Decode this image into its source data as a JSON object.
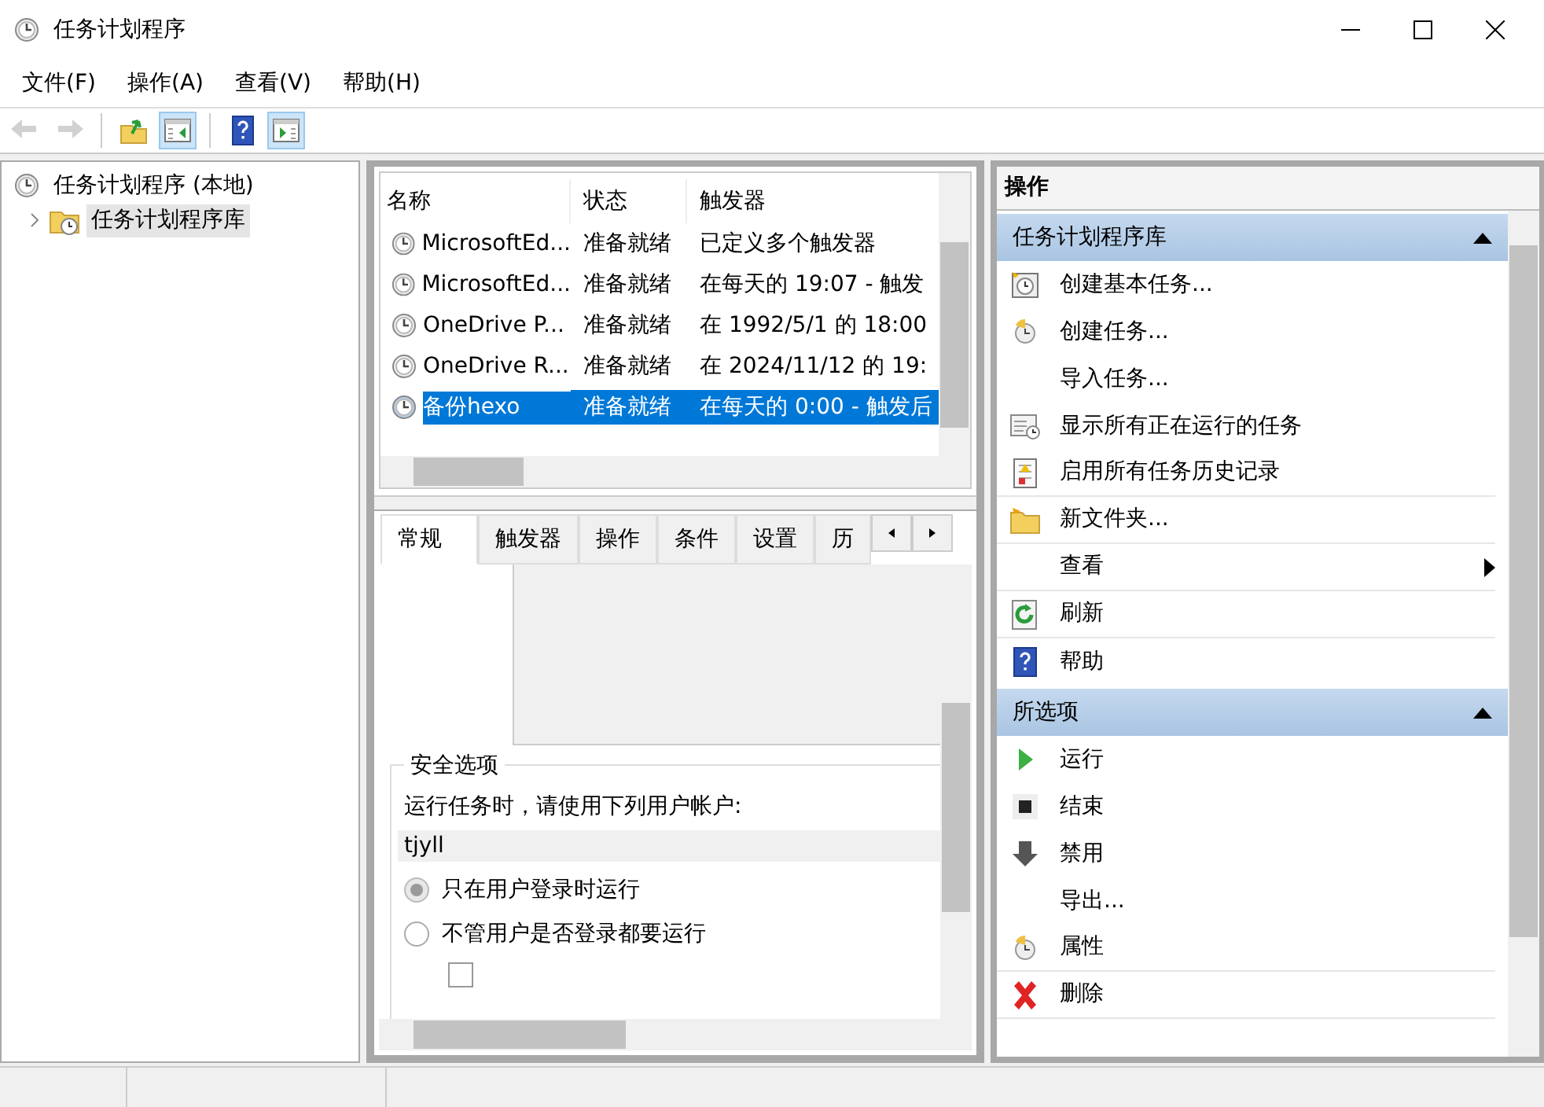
{
  "window": {
    "title": "任务计划程序"
  },
  "menu": [
    {
      "label": "文件(F)"
    },
    {
      "label": "操作(A)"
    },
    {
      "label": "查看(V)"
    },
    {
      "label": "帮助(H)"
    }
  ],
  "toolbar": [
    {
      "kind": "back",
      "disabled": true,
      "on": false
    },
    {
      "kind": "forward",
      "disabled": true,
      "on": false
    },
    {
      "kind": "up",
      "disabled": false,
      "on": false
    },
    {
      "kind": "console-tree",
      "disabled": false,
      "on": true
    },
    {
      "kind": "help",
      "disabled": false,
      "on": false
    },
    {
      "kind": "action-pane",
      "disabled": false,
      "on": true
    }
  ],
  "tree": [
    {
      "label": "任务计划程序 (本地)",
      "selected": false,
      "children": [
        {
          "label": "任务计划程序库",
          "selected": true,
          "expanded": false
        }
      ]
    }
  ],
  "tasks": {
    "columns": [
      "名称",
      "状态",
      "触发器"
    ],
    "rows": [
      {
        "name": "MicrosoftEd...",
        "status": "准备就绪",
        "trigger": "已定义多个触发器",
        "selected": false
      },
      {
        "name": "MicrosoftEd...",
        "status": "准备就绪",
        "trigger": "在每天的 19:07 - 触发",
        "selected": false
      },
      {
        "name": "OneDrive P...",
        "status": "准备就绪",
        "trigger": "在 1992/5/1 的 18:00",
        "selected": false
      },
      {
        "name": "OneDrive R...",
        "status": "准备就绪",
        "trigger": "在 2024/11/12 的 19:",
        "selected": false
      },
      {
        "name": "备份hexo",
        "status": "准备就绪",
        "trigger": "在每天的 0:00 - 触发后",
        "selected": true
      }
    ]
  },
  "detail": {
    "tabs": [
      {
        "label": "常规",
        "selected": true
      },
      {
        "label": "触发器",
        "selected": false
      },
      {
        "label": "操作",
        "selected": false
      },
      {
        "label": "条件",
        "selected": false
      },
      {
        "label": "设置",
        "selected": false
      },
      {
        "label": "历",
        "selected": false
      }
    ],
    "security": {
      "legend": "安全选项",
      "prompt": "运行任务时，请使用下列用户帐户:",
      "account": "tjyll",
      "options": [
        {
          "label": "只在用户登录时运行",
          "selected": true
        },
        {
          "label": "不管用户是否登录都要运行",
          "selected": false
        }
      ],
      "checkbox": {
        "checked": false
      }
    }
  },
  "actions": {
    "title": "操作",
    "sections": [
      {
        "title": "任务计划程序库",
        "expanded": true,
        "items": [
          {
            "label": "创建基本任务...",
            "kind": "basic-task",
            "submenu": false,
            "divider": false
          },
          {
            "label": "创建任务...",
            "kind": "task",
            "submenu": false,
            "divider": false
          },
          {
            "label": "导入任务...",
            "kind": "none",
            "submenu": false,
            "divider": false
          },
          {
            "label": "显示所有正在运行的任务",
            "kind": "running",
            "submenu": false,
            "divider": false
          },
          {
            "label": "启用所有任务历史记录",
            "kind": "history",
            "submenu": false,
            "divider": true
          },
          {
            "label": "新文件夹...",
            "kind": "folder",
            "submenu": false,
            "divider": true
          },
          {
            "label": "查看",
            "kind": "none",
            "submenu": true,
            "divider": true
          },
          {
            "label": "刷新",
            "kind": "refresh",
            "submenu": false,
            "divider": true
          },
          {
            "label": "帮助",
            "kind": "help",
            "submenu": false,
            "divider": false
          }
        ]
      },
      {
        "title": "所选项",
        "expanded": true,
        "items": [
          {
            "label": "运行",
            "kind": "run",
            "submenu": false,
            "divider": false
          },
          {
            "label": "结束",
            "kind": "stop",
            "submenu": false,
            "divider": false
          },
          {
            "label": "禁用",
            "kind": "disable",
            "submenu": false,
            "divider": false
          },
          {
            "label": "导出...",
            "kind": "none",
            "submenu": false,
            "divider": false
          },
          {
            "label": "属性",
            "kind": "task",
            "submenu": false,
            "divider": true
          },
          {
            "label": "删除",
            "kind": "delete",
            "submenu": false,
            "divider": true
          }
        ]
      }
    ]
  }
}
